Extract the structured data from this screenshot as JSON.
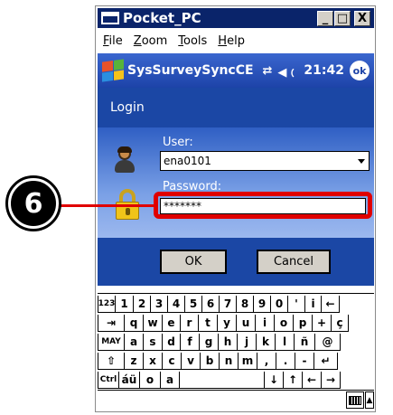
{
  "window": {
    "title": "Pocket_PC",
    "minimize_label": "_",
    "restore_label": "□",
    "close_label": "X"
  },
  "menu": {
    "items": [
      "File",
      "Zoom",
      "Tools",
      "Help"
    ]
  },
  "navbar": {
    "app_title": "SysSurveySyncCE",
    "connectivity_icon": "sync-arrows-icon",
    "volume_icon": "speaker-icon",
    "time": "21:42",
    "ok_label": "ok"
  },
  "login": {
    "header": "Login",
    "user_label": "User:",
    "user_value": "ena0101",
    "password_label": "Password:",
    "password_value": "*******",
    "ok_button": "OK",
    "cancel_button": "Cancel"
  },
  "callout": {
    "step_number": "6",
    "highlight_color": "#e00000"
  },
  "keyboard": {
    "rows": [
      [
        "123",
        "1",
        "2",
        "3",
        "4",
        "5",
        "6",
        "7",
        "8",
        "9",
        "0",
        "'",
        "i",
        "←"
      ],
      [
        "⇥",
        "q",
        "w",
        "e",
        "r",
        "t",
        "y",
        "u",
        "i",
        "o",
        "p",
        "+",
        "ç"
      ],
      [
        "MAY",
        "a",
        "s",
        "d",
        "f",
        "g",
        "h",
        "j",
        "k",
        "l",
        "ñ",
        "@"
      ],
      [
        "⇧",
        "z",
        "x",
        "c",
        "v",
        "b",
        "n",
        "m",
        ",",
        ".",
        "-",
        "↵"
      ],
      [
        "Ctrl",
        "áü",
        "o",
        "a",
        "",
        "↓",
        "↑",
        "←",
        "→"
      ]
    ],
    "input_icon": "keyboard-icon",
    "input_arrow": "▲"
  },
  "colors": {
    "titlebar": "#0a246a",
    "navbar": "#2a55bd",
    "login_panel": "#1b47a5",
    "highlight": "#e00000"
  }
}
